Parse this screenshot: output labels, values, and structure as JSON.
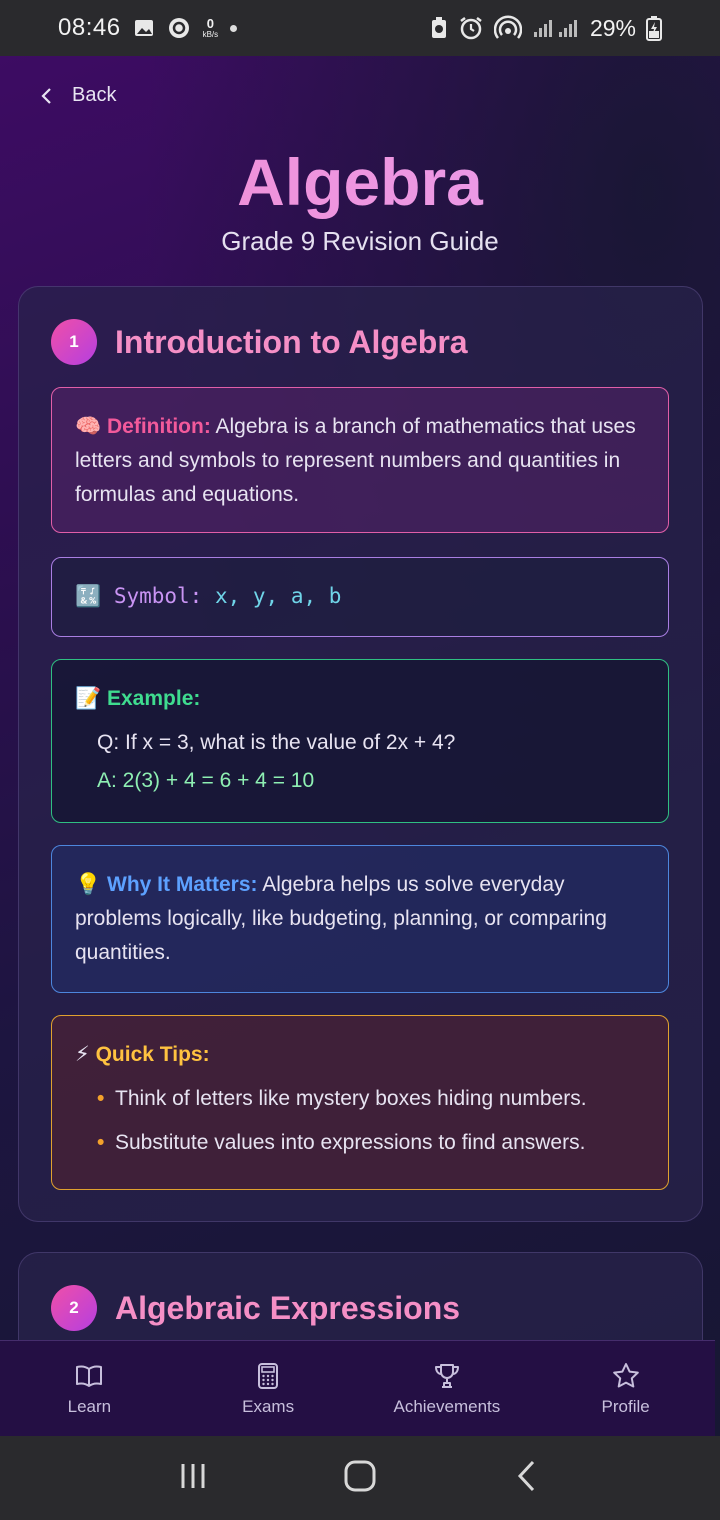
{
  "status_bar": {
    "time": "08:46",
    "net_speed_value": "0",
    "net_speed_unit": "kB/s",
    "battery": "29%"
  },
  "header": {
    "back_label": "Back",
    "title": "Algebra",
    "subtitle": "Grade 9 Revision Guide"
  },
  "sections": [
    {
      "number": "1",
      "title": "Introduction to Algebra",
      "definition": {
        "emoji": "🧠",
        "label": "Definition:",
        "text": "Algebra is a branch of mathematics that uses letters and symbols to represent numbers and quantities in formulas and equations."
      },
      "symbol": {
        "emoji": "🔣",
        "label": "Symbol:",
        "values": "x, y, a, b"
      },
      "example": {
        "emoji": "📝",
        "label": "Example:",
        "question": "Q: If x = 3, what is the value of 2x + 4?",
        "answer": "A: 2(3) + 4 = 6 + 4 = 10"
      },
      "why": {
        "emoji": "💡",
        "label": "Why It Matters:",
        "text": "Algebra helps us solve everyday problems logically, like budgeting, planning, or comparing quantities."
      },
      "tips": {
        "emoji": "⚡",
        "label": "Quick Tips:",
        "items": [
          "Think of letters like mystery boxes hiding numbers.",
          "Substitute values into expressions to find answers."
        ]
      }
    },
    {
      "number": "2",
      "title": "Algebraic Expressions"
    }
  ],
  "bottom_nav": [
    {
      "label": "Learn",
      "icon": "book-icon"
    },
    {
      "label": "Exams",
      "icon": "calculator-icon"
    },
    {
      "label": "Achievements",
      "icon": "trophy-icon"
    },
    {
      "label": "Profile",
      "icon": "star-icon"
    }
  ],
  "colors": {
    "accent_pink": "#f58fc6",
    "example_green": "#3fdc8f",
    "why_blue": "#5da1ff",
    "tips_amber": "#ffc240"
  }
}
